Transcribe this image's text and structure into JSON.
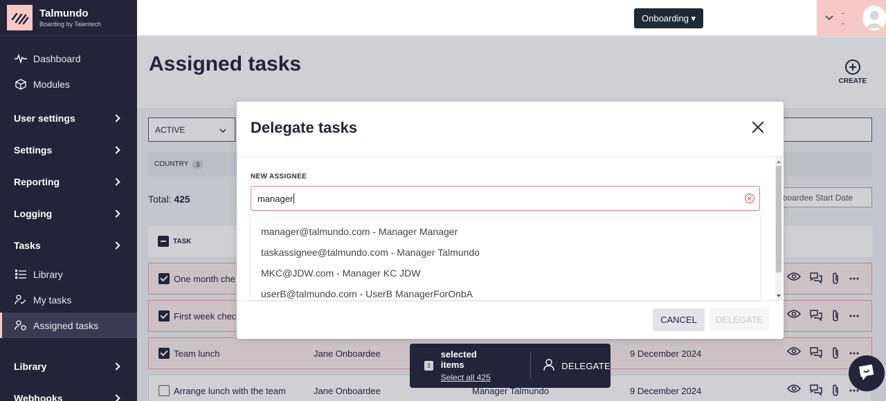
{
  "brand": {
    "name": "Talmundo",
    "tagline": "Boarding by Talentech"
  },
  "sidebar": {
    "items": [
      {
        "label": "Dashboard"
      },
      {
        "label": "Modules"
      }
    ],
    "groups": [
      "User settings",
      "Settings",
      "Reporting",
      "Logging",
      "Tasks"
    ],
    "task_items": [
      {
        "label": "Library"
      },
      {
        "label": "My tasks"
      },
      {
        "label": "Assigned tasks"
      }
    ],
    "bottom_groups": [
      "Library",
      "Webhooks"
    ]
  },
  "topbar": {
    "onboarding_label": "Onboarding ▾",
    "user_dash": "- -"
  },
  "page": {
    "title": "Assigned tasks",
    "create_label": "CREATE",
    "filter_value": "ACTIVE",
    "country_label": "COUNTRY",
    "country_count": "3",
    "total_label": "Total:",
    "total_value": "425",
    "sort_label": "nboardee Start Date",
    "task_header": "TASK"
  },
  "rows": [
    {
      "task": "One month che",
      "onboardee": "",
      "assignee": "",
      "date": ""
    },
    {
      "task": "First week chec",
      "onboardee": "",
      "assignee": "",
      "date": ""
    },
    {
      "task": "Team lunch",
      "onboardee": "Jane Onboardee",
      "assignee": "",
      "date": "9 December 2024"
    },
    {
      "task": "Arrange lunch with the team",
      "onboardee": "Jane Onboardee",
      "assignee": "Manager Talmundo",
      "date": "9 December 2024"
    }
  ],
  "selection": {
    "count": "3",
    "label": "selected items",
    "select_all": "Select all 425",
    "delegate": "DELEGATE"
  },
  "modal": {
    "title": "Delegate tasks",
    "field_label": "NEW ASSIGNEE",
    "input_value": "manager",
    "options": [
      "manager@talmundo.com - Manager Manager",
      "taskassignee@talmundo.com - Manager Talmundo",
      "MKC@JDW.com - Manager KC JDW",
      "userB@talmundo.com - UserB ManagerForOnbA"
    ],
    "cancel_label": "CANCEL",
    "delegate_label": "DELEGATE"
  },
  "colors": {
    "navy": "#23233a",
    "pink": "#f6c9c7",
    "error": "#e07c78"
  }
}
